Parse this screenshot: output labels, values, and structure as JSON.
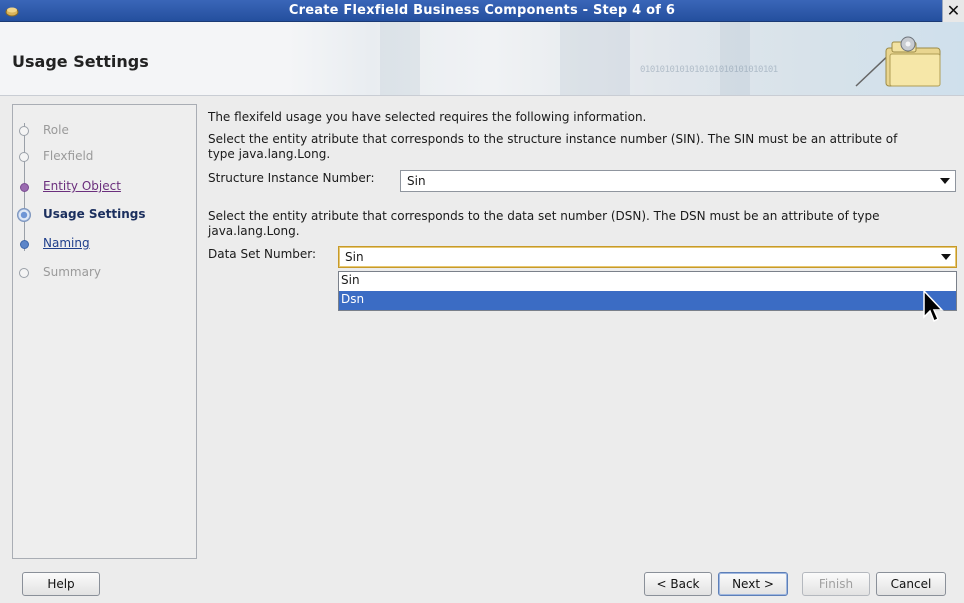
{
  "window": {
    "title": "Create Flexfield Business Components - Step 4 of 6",
    "close_glyph": "✕"
  },
  "header": {
    "heading": "Usage Settings",
    "banner_binary": "0101010101010101010101010101",
    "wizard_icon": "folder-gear-wizard-icon"
  },
  "steps": [
    {
      "label": "Role",
      "state": "disabled"
    },
    {
      "label": "Flexfield",
      "state": "disabled"
    },
    {
      "label": "Entity Object",
      "state": "visited"
    },
    {
      "label": "Usage Settings",
      "state": "current"
    },
    {
      "label": "Naming",
      "state": "link"
    },
    {
      "label": "Summary",
      "state": "disabled"
    }
  ],
  "content": {
    "intro": "The flexifeld usage you have selected requires the following information.",
    "sin_desc_line1": "Select the entity atribute that corresponds to the structure instance number (SIN). The SIN must be an attribute of",
    "sin_desc_line2": "type java.lang.Long.",
    "sin_label": "Structure Instance Number:",
    "sin_value": "Sin",
    "dsn_desc_line1": "Select the entity atribute that corresponds to the data set number (DSN). The DSN must be an attribute of type",
    "dsn_desc_line2": "java.lang.Long.",
    "dsn_label": "Data Set Number:",
    "dsn_value": "Sin",
    "dsn_options": [
      "Sin",
      "Dsn"
    ],
    "dsn_highlighted_option": "Dsn"
  },
  "footer": {
    "help_label": "Help",
    "back_label": "< Back",
    "next_label": "Next >",
    "finish_label": "Finish",
    "cancel_label": "Cancel"
  },
  "colors": {
    "title_bar": "#2f5bab",
    "selection": "#3b6cc4",
    "visited_link": "#6b2f7d",
    "link": "#1f3f8c"
  }
}
